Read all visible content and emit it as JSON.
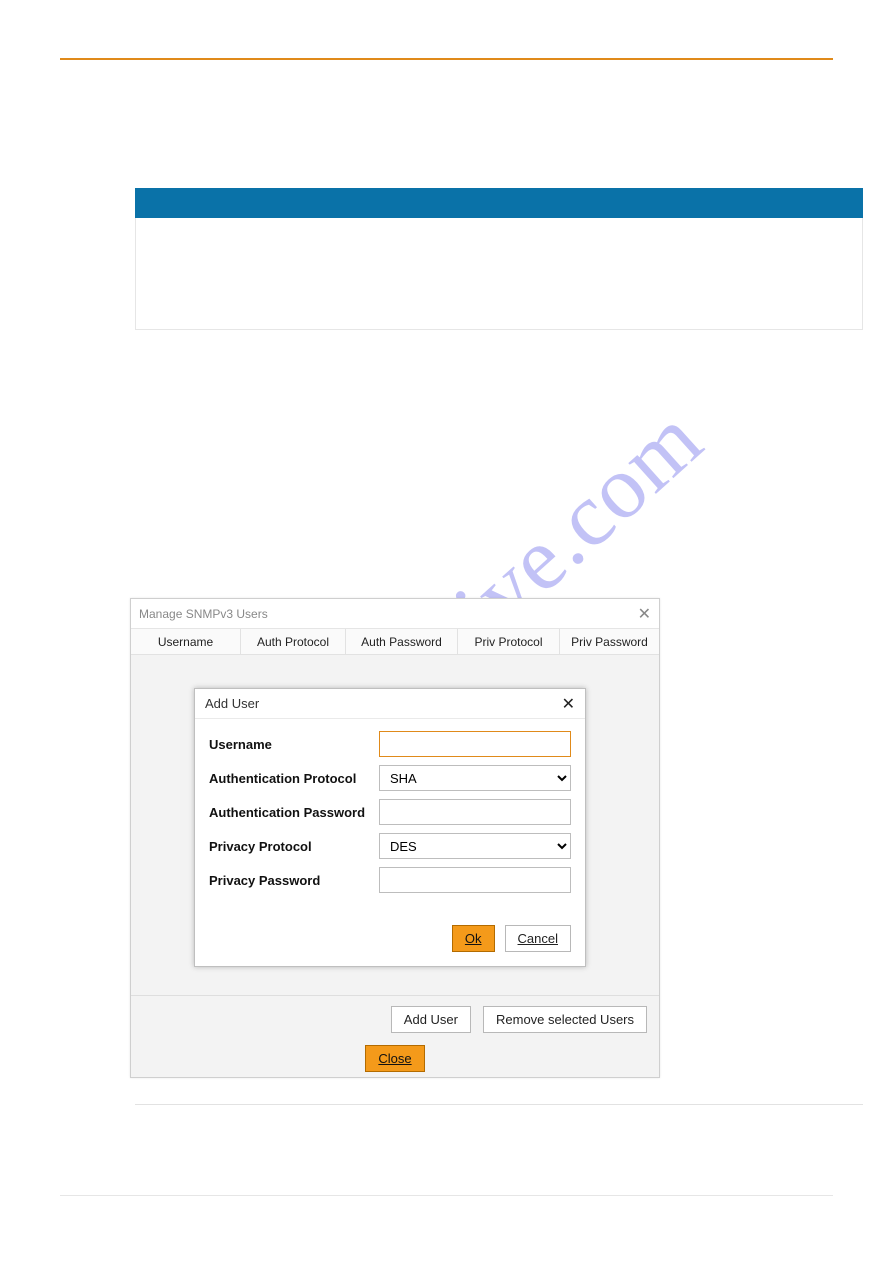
{
  "watermark_text": "manualshive.com",
  "outer_dialog": {
    "title": "Manage SNMPv3 Users",
    "columns": [
      "Username",
      "Auth Protocol",
      "Auth Password",
      "Priv Protocol",
      "Priv Password"
    ],
    "buttons": {
      "add_user": "Add User",
      "remove": "Remove selected Users",
      "close": "Close"
    }
  },
  "inner_dialog": {
    "title": "Add User",
    "fields": {
      "username_label": "Username",
      "username_value": "",
      "auth_protocol_label": "Authentication Protocol",
      "auth_protocol_value": "SHA",
      "auth_password_label": "Authentication Password",
      "auth_password_value": "",
      "priv_protocol_label": "Privacy Protocol",
      "priv_protocol_value": "DES",
      "priv_password_label": "Privacy Password",
      "priv_password_value": ""
    },
    "buttons": {
      "ok": "Ok",
      "cancel": "Cancel"
    }
  }
}
